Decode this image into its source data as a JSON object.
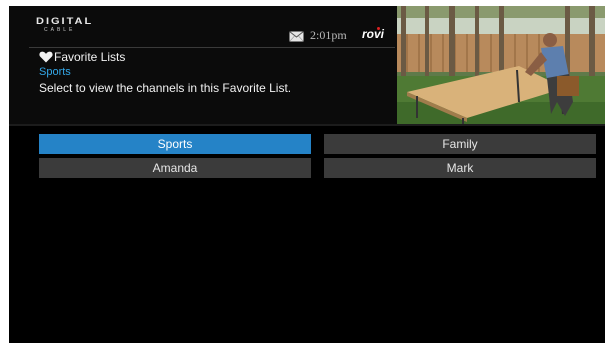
{
  "header": {
    "logo_main": "DIGITAL",
    "logo_sub": "CABLE",
    "time": "2:01pm",
    "brand": "rovi"
  },
  "favorites": {
    "title": "Favorite Lists",
    "current_list": "Sports",
    "instructions": "Select to view the channels in this Favorite List."
  },
  "lists": [
    {
      "label": "Sports",
      "selected": true
    },
    {
      "label": "Family",
      "selected": false
    },
    {
      "label": "Amanda",
      "selected": false
    },
    {
      "label": "Mark",
      "selected": false
    }
  ],
  "colors": {
    "accent": "#2583c7",
    "accent_text": "#33a7e8",
    "button": "#3b3b3b",
    "background": "#000000"
  },
  "icons": {
    "mail": "envelope-icon",
    "favorite": "heart-icon"
  }
}
